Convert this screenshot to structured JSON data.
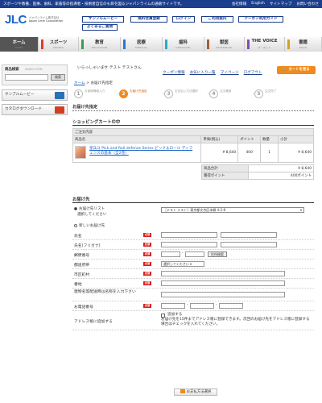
{
  "topbar": {
    "message": "スポーツや教養、医療、歯科、家畜等の指導者・技術者自信のも目を図るジャパンライムの通販サイトです。",
    "links": [
      "会社情報",
      "English",
      "サイトマップ",
      "お問い合わせ"
    ]
  },
  "logo": {
    "mark": "JLC",
    "sub1": "ジャパンライム株式会社",
    "sub2": "Japan Lime Corporation"
  },
  "header_buttons": {
    "sample_movie": "サンプルムービー",
    "member_register": "無料会員登録",
    "login": "ログイン",
    "guide": "ご利用案内",
    "coupon_guide": "クーポン利用ガイド",
    "faq": "よくあるご質問"
  },
  "nav": {
    "tabs": [
      {
        "label": "ホーム",
        "en": "HOME"
      },
      {
        "label": "スポーツ",
        "en": "SPORTS"
      },
      {
        "label": "教育",
        "en": "EDUCATION"
      },
      {
        "label": "医療",
        "en": "MEDICAL"
      },
      {
        "label": "歯科",
        "en": "DENTISTRY"
      },
      {
        "label": "獣医",
        "en": "VETERINARY"
      },
      {
        "label": "THE VOICE",
        "en": "ザ・ボイス"
      },
      {
        "label": "書籍",
        "en": "BOOK"
      }
    ]
  },
  "sidebar": {
    "search_label": "商品検索",
    "search_label_en": "SEARCH ITEM",
    "search_value": "",
    "search_button": "検索",
    "sample_movie": "サンプルムービー",
    "catalog_download": "カタログダウンロード"
  },
  "main": {
    "welcome": "いらっしゃいませ テスト テストさん",
    "util_links": [
      "クーポン情報",
      "お気に入り一覧",
      "マイページ",
      "ログアウト"
    ],
    "cart_button": "カートを見る",
    "breadcrumb_home": "ホーム",
    "breadcrumb_sep": " > ",
    "breadcrumb_current": "お届け先指定",
    "steps": [
      {
        "num": "1",
        "label": "お客様情報入力"
      },
      {
        "num": "2",
        "label": "お届け先指定"
      },
      {
        "num": "3",
        "label": "お支払い方法選択"
      },
      {
        "num": "4",
        "label": "注文確認"
      },
      {
        "num": "5",
        "label": "注文完了"
      }
    ],
    "page_heading": "お届け先指定"
  },
  "cart": {
    "heading": "ショッピングカートの中",
    "caption": "ご注文内容",
    "columns": [
      "商品名",
      "単価(税込)",
      "ポイント",
      "数量",
      "小計"
    ],
    "rows": [
      {
        "name": "星兵斗 Pick and Roll defense Series ピック＆ロール ディフェンスの基本（全2巻）",
        "price": "¥ 8,640",
        "points": "400",
        "qty": "1",
        "subtotal": "¥ 8,640"
      }
    ],
    "total_label": "商品合計",
    "total_value": "¥ 8,640",
    "points_label": "獲得ポイント",
    "points_value": "400ポイント"
  },
  "delivery": {
    "heading": "お届け先",
    "option_list": "お届け先リスト",
    "select_label": "選択してください",
    "select_value": "［テスト テスト］東京都文京区本郷 4-2-8",
    "option_new": "新しいお届け先",
    "required": "必須",
    "fields": {
      "name": "氏名",
      "kana": "氏名(フリガナ)",
      "zip": "郵便番号",
      "zip_search": "住所検索",
      "prefecture": "都道府県",
      "prefecture_placeholder": "選択してください",
      "city": "市区町村",
      "street": "番地",
      "building": "建物名等配送時は名称を入力下さい",
      "phone": "お電話番号",
      "save_to_book": "アドレス帳に追加する",
      "save_checkbox_label": "追加する",
      "save_note": "お届け先を15件までアドレス帳に登録できます。次回のお届け先をアドレス帳に登録する場合はチェックを入れてください。"
    },
    "confirm_button": "お支払方法選択"
  },
  "colors": {
    "topbar": "#1b3f8c",
    "accent_orange": "#f08a1c",
    "required_red": "#d62020",
    "link_blue": "#1b63c6"
  }
}
